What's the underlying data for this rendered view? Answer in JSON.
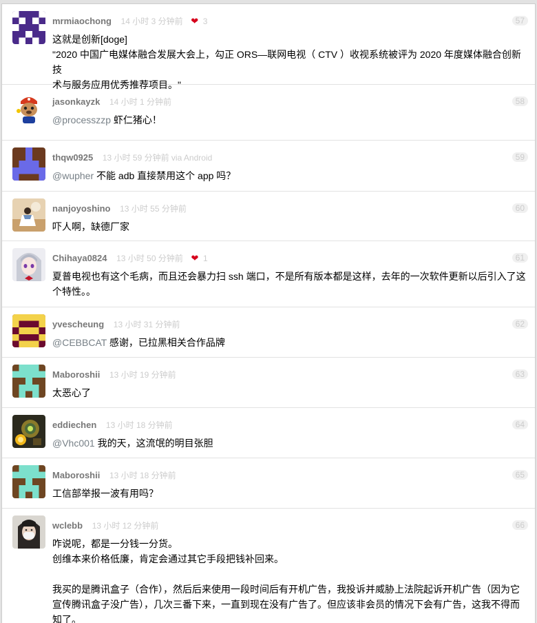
{
  "colors": {
    "username": "#777777",
    "meta": "#cccccc",
    "heart": "#d6001c",
    "mention": "#778087",
    "background": "#e2e2e2"
  },
  "replies": [
    {
      "username": "mrmiaochong",
      "time": "14 小时 3 分钟前",
      "heart": "❤",
      "likes": "3",
      "number": "57",
      "avatar_icon": "purple-pixel-identicon",
      "content": [
        "这就是创新[doge]",
        "\"2020 中国广电媒体融合发展大会上，勾正 ORS—联网电视（ CTV ）收视系统被评为 2020 年度媒体融合创新技",
        "术与服务应用优秀推荐项目。\""
      ]
    },
    {
      "username": "jasonkayzk",
      "time": "14 小时 1 分钟前",
      "number": "58",
      "avatar_icon": "cartoon-otter-avatar",
      "mention": "@processzzp",
      "text": " 虾仁猪心！"
    },
    {
      "username": "thqw0925",
      "time": "13 小时 59 分钟前 via Android",
      "number": "59",
      "avatar_icon": "blue-pixel-identicon",
      "mention": "@wupher",
      "text": " 不能 adb 直接禁用这个 app 吗？"
    },
    {
      "username": "nanjoyoshino",
      "time": "13 小时 55 分钟前",
      "number": "60",
      "avatar_icon": "anime-photo-avatar",
      "content": [
        "吓人啊，缺德厂家"
      ]
    },
    {
      "username": "Chihaya0824",
      "time": "13 小时 50 分钟前",
      "heart": "❤",
      "likes": "1",
      "number": "61",
      "avatar_icon": "anime-girl-avatar",
      "content": [
        "夏普电视也有这个毛病，而且还会暴力扫 ssh 端口，不是所有版本都是这样，去年的一次软件更新以后引入了这",
        "个特性。。"
      ]
    },
    {
      "username": "yvescheung",
      "time": "13 小时 31 分钟前",
      "number": "62",
      "avatar_icon": "yellow-maroon-pixel-identicon",
      "mention": "@CEBBCAT",
      "text": " 感谢，已拉黑相关合作品牌"
    },
    {
      "username": "Maboroshii",
      "time": "13 小时 19 分钟前",
      "number": "63",
      "avatar_icon": "teal-pixel-identicon",
      "content": [
        "太恶心了"
      ]
    },
    {
      "username": "eddiechen",
      "time": "13 小时 18 分钟前",
      "number": "64",
      "avatar_icon": "robot-character-avatar",
      "mention": "@Vhc001",
      "text": " 我的天，这流氓的明目张胆"
    },
    {
      "username": "Maboroshii",
      "time": "13 小时 18 分钟前",
      "number": "65",
      "avatar_icon": "teal-pixel-identicon",
      "content": [
        "工信部举报一波有用吗？"
      ]
    },
    {
      "username": "wclebb",
      "time": "13 小时 12 分钟前",
      "number": "66",
      "avatar_icon": "masked-person-photo-avatar",
      "content": [
        "咋说呢，都是一分钱一分货。",
        "创维本来价格低廉，肯定会通过其它手段把钱补回来。",
        "",
        "我买的是腾讯盒子（合作），然后后来使用一段时间后有开机广告，我投诉并威胁上法院起诉开机广告（因为它",
        "宣传腾讯盒子没广告），几次三番下来，一直到现在没有广告了。但应该非会员的情况下会有广告，这我不得而",
        "知了。"
      ]
    }
  ]
}
